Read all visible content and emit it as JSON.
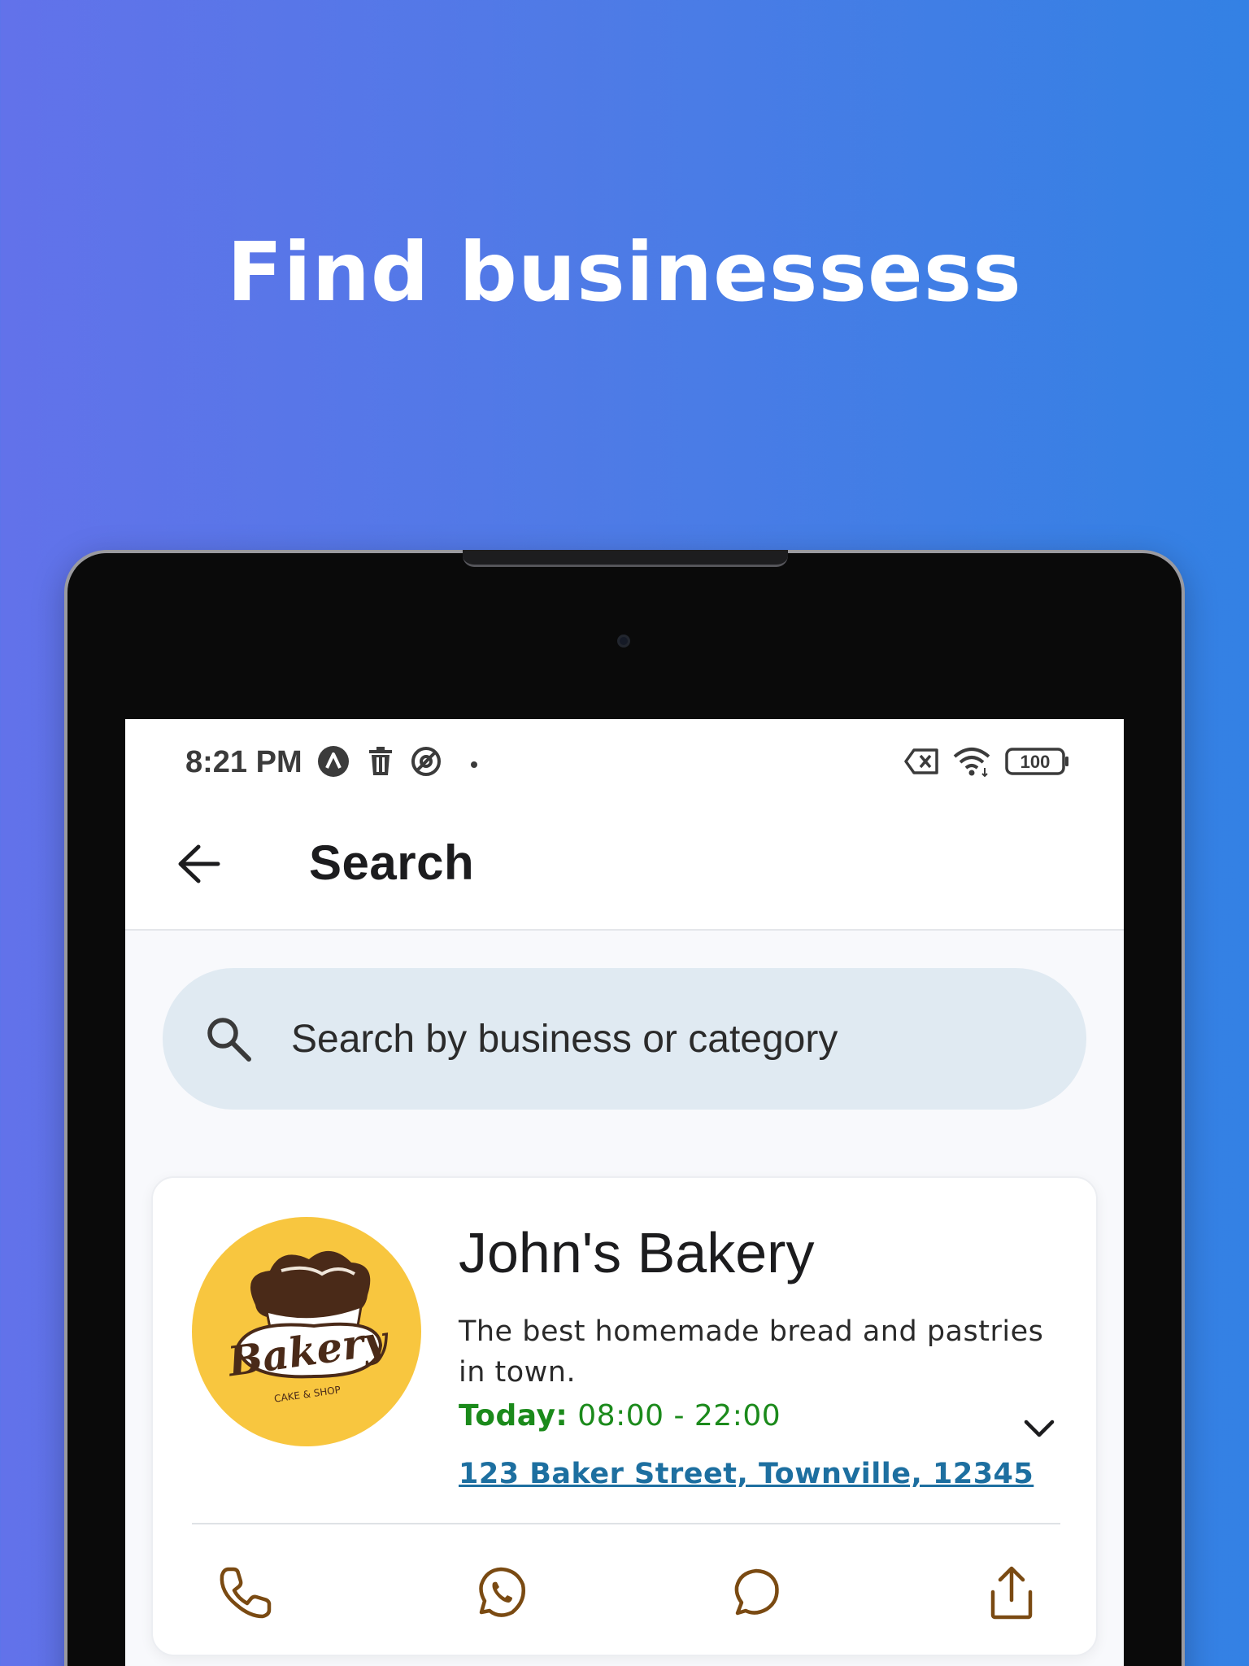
{
  "promo": {
    "headline": "Find businessess"
  },
  "status_bar": {
    "time": "8:21 PM",
    "battery": "100",
    "left_icons": [
      "app-notification-icon",
      "trash-icon",
      "at-sign-icon",
      "dot-icon"
    ],
    "right_icons": [
      "no-sim-icon",
      "wifi-icon",
      "battery-icon"
    ]
  },
  "app_bar": {
    "title": "Search",
    "back_icon": "arrow-left-icon"
  },
  "search": {
    "placeholder": "Search by business or category",
    "value": ""
  },
  "results": [
    {
      "name": "John's Bakery",
      "description": "The best homemade bread and pastries in town.",
      "hours_label": "Today:",
      "hours_value": "08:00 - 22:00",
      "address": "123 Baker Street, Townville, 12345",
      "logo": {
        "text": "Bakery",
        "subtext": "CAKE & SHOP",
        "background": "#f8c63f"
      },
      "actions": [
        "phone-icon",
        "whatsapp-icon",
        "message-icon",
        "share-icon"
      ]
    }
  ],
  "colors": {
    "gradient_start": "#6272ea",
    "gradient_end": "#3381e4",
    "hours_green": "#1b8a1b",
    "address_blue": "#1d6fa0",
    "action_brown": "#7a4a12",
    "search_bg": "#e0eaf2"
  }
}
